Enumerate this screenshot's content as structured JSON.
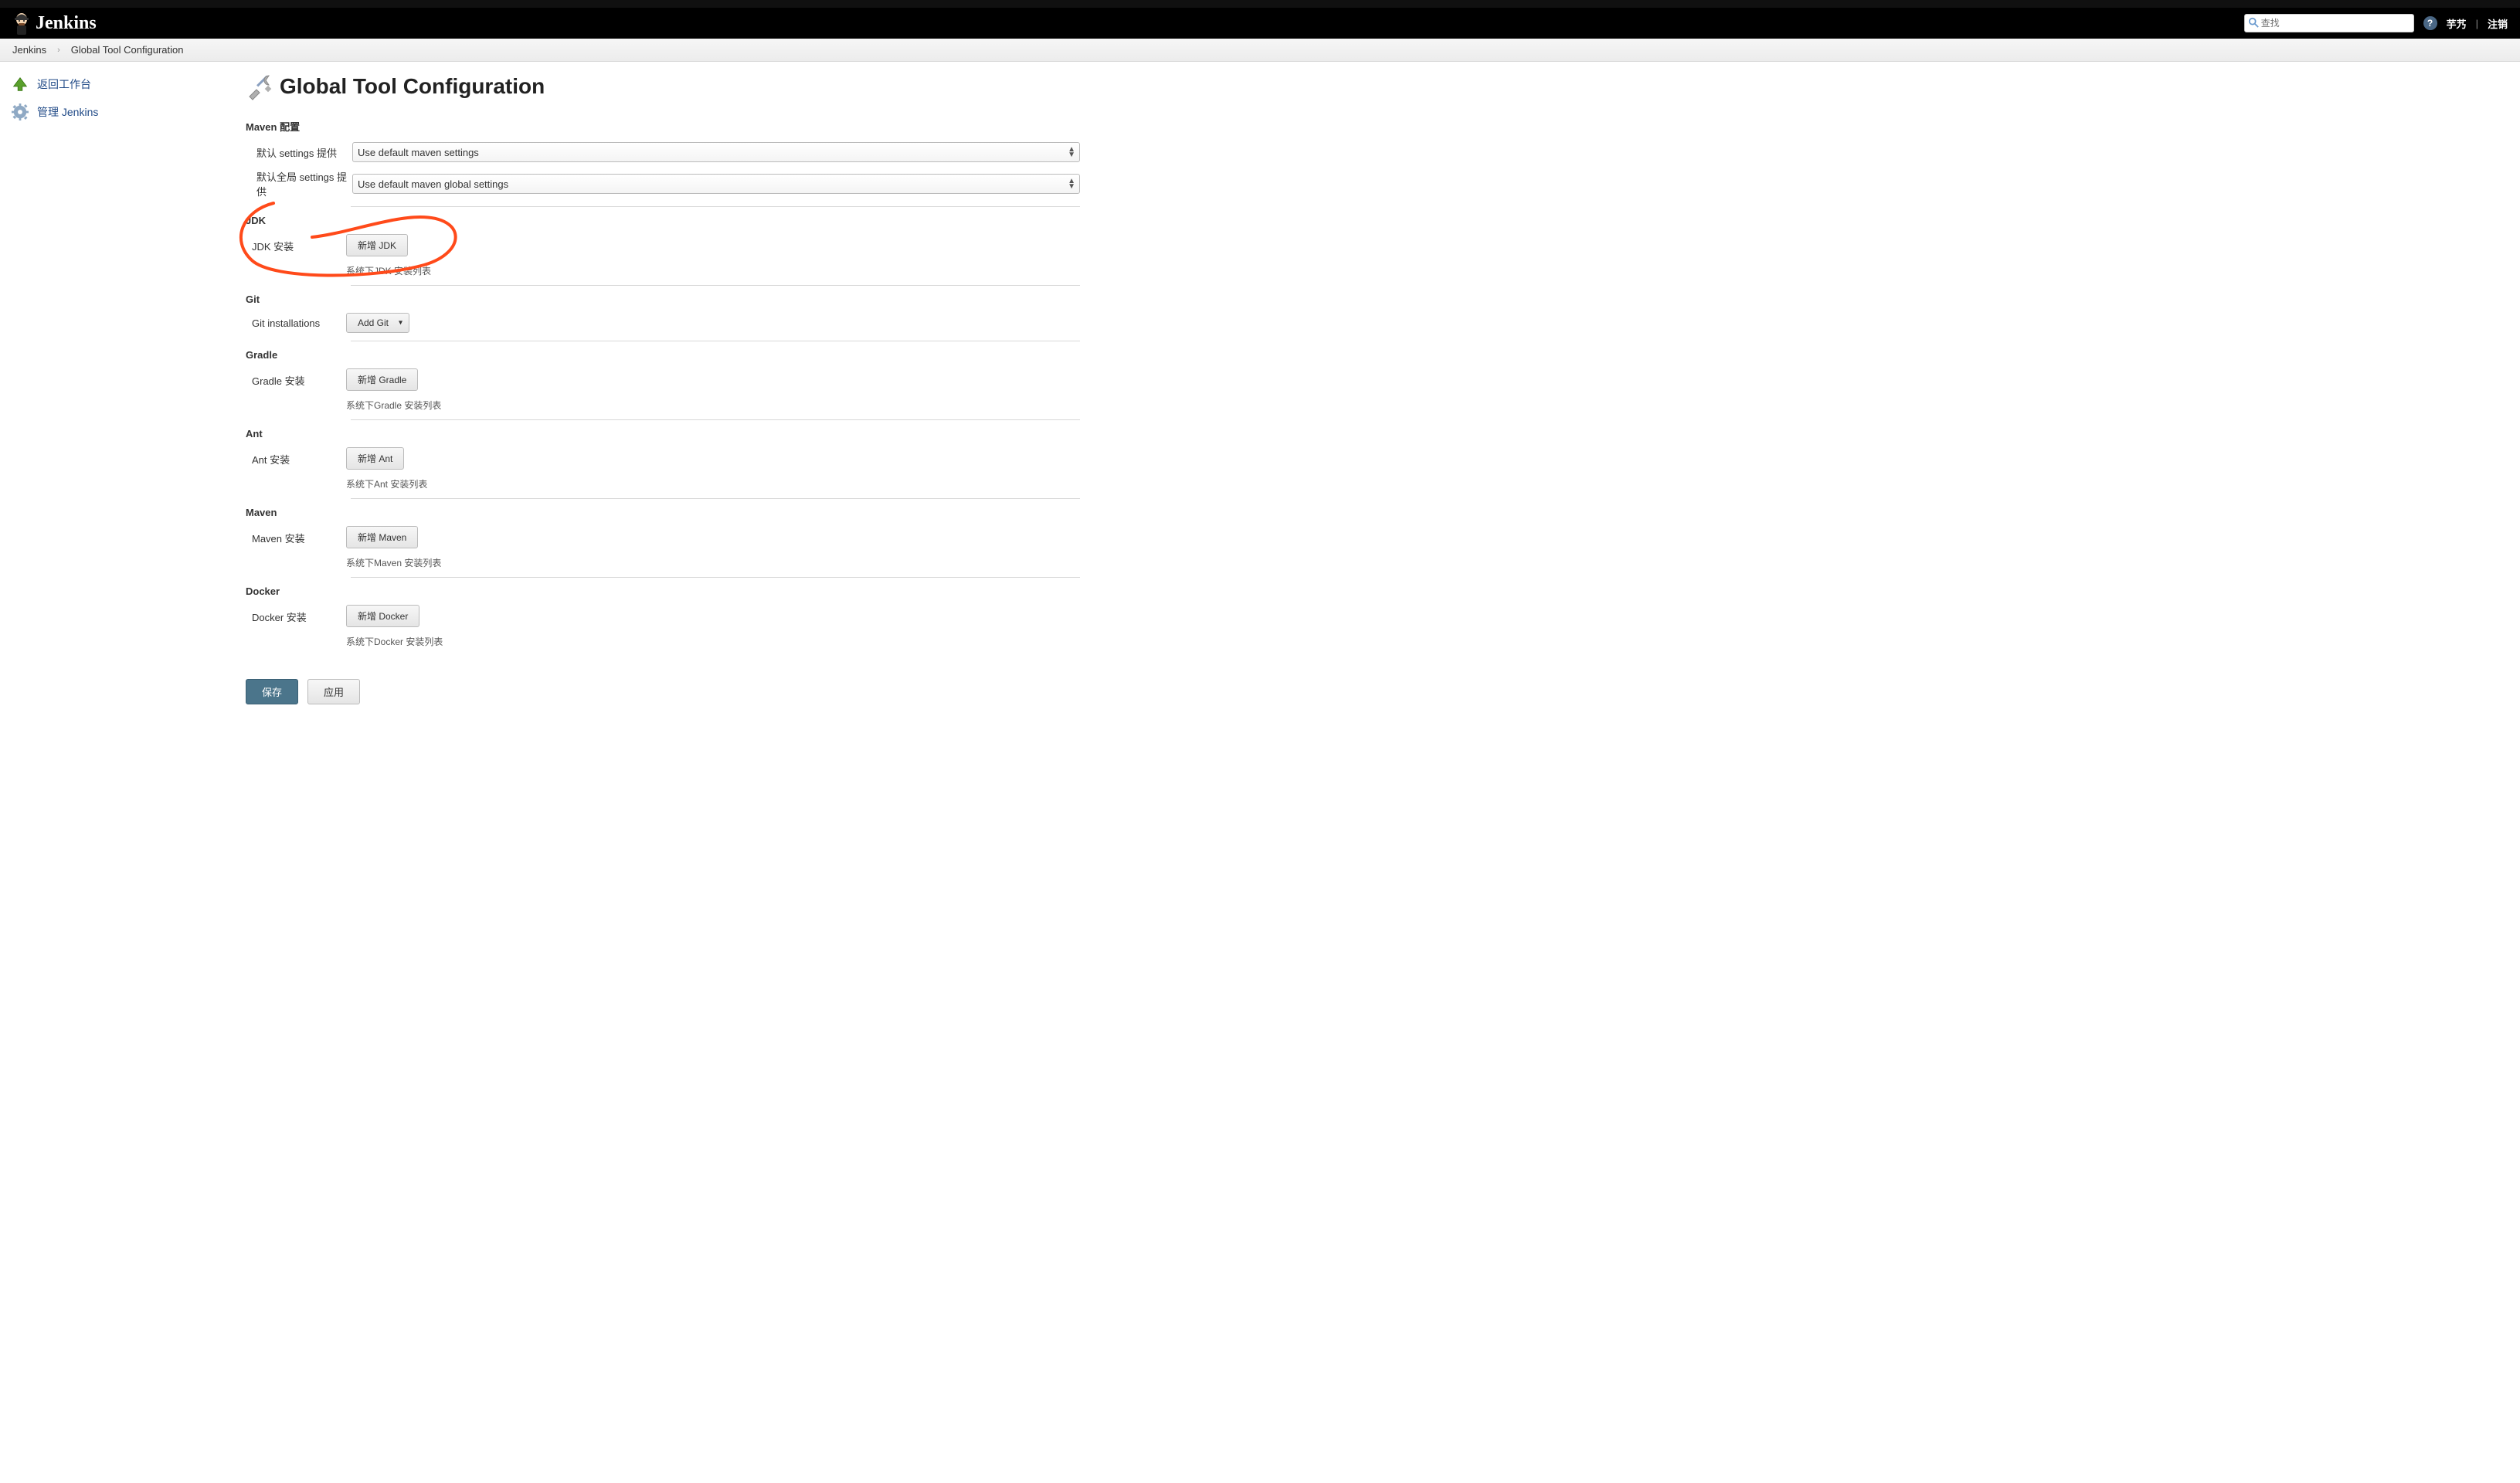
{
  "header": {
    "logo_text": "Jenkins",
    "search_placeholder": "查找",
    "help_char": "?",
    "user_label": "芋艿",
    "sep": "|",
    "logout_label": "注销"
  },
  "breadcrumb": {
    "items": [
      "Jenkins",
      "Global Tool Configuration"
    ],
    "sep": "›"
  },
  "sidebar": {
    "items": [
      {
        "label": "返回工作台",
        "icon": "arrow-up"
      },
      {
        "label": "管理 Jenkins",
        "icon": "gear"
      }
    ]
  },
  "main": {
    "title": "Global Tool Configuration",
    "maven_cfg": {
      "section": "Maven 配置",
      "default_settings_label": "默认 settings 提供",
      "default_settings_value": "Use default maven settings",
      "global_settings_label": "默认全局 settings 提供",
      "global_settings_value": "Use default maven global settings"
    },
    "tools": [
      {
        "section": "JDK",
        "install_label": "JDK 安装",
        "button": "新增 JDK",
        "desc": "系统下JDK 安装列表",
        "annotated": true
      },
      {
        "section": "Git",
        "install_label": "Git installations",
        "button": "Add Git",
        "dropdown": true,
        "desc": ""
      },
      {
        "section": "Gradle",
        "install_label": "Gradle 安装",
        "button": "新增 Gradle",
        "desc": "系统下Gradle 安装列表"
      },
      {
        "section": "Ant",
        "install_label": "Ant 安装",
        "button": "新增 Ant",
        "desc": "系统下Ant 安装列表"
      },
      {
        "section": "Maven",
        "install_label": "Maven 安装",
        "button": "新增 Maven",
        "desc": "系统下Maven 安装列表"
      },
      {
        "section": "Docker",
        "install_label": "Docker 安装",
        "button": "新增 Docker",
        "desc": "系统下Docker 安装列表"
      }
    ],
    "footer": {
      "save": "保存",
      "apply": "应用"
    }
  },
  "colors": {
    "annotation": "#ff4a1a"
  }
}
